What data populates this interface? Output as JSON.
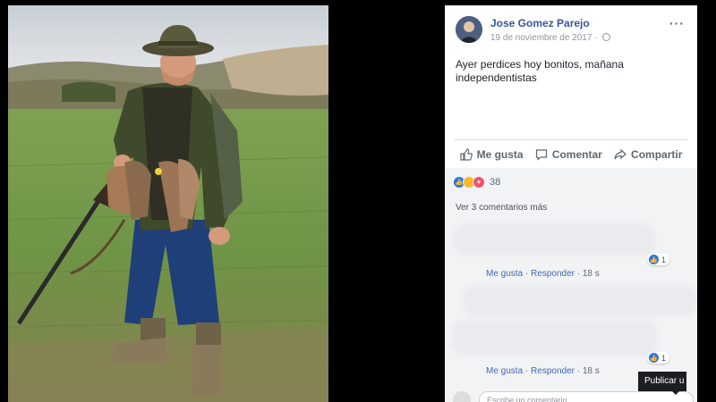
{
  "post": {
    "author": "Jose Gomez Parejo",
    "date": "19 de noviembre de 2017 ·",
    "text": "Ayer perdices hoy bonitos, mañana independentistas",
    "more_icon": "ellipsis-icon"
  },
  "actions": {
    "like": "Me gusta",
    "comment": "Comentar",
    "share": "Compartir"
  },
  "reactions": {
    "icons": [
      "like-icon",
      "haha-icon",
      "love-icon"
    ],
    "count": "38"
  },
  "comments": {
    "view_more": "Ver 3 comentarios más",
    "items": [
      {
        "like_label": "Me gusta",
        "reply_label": "Responder",
        "time": "· 18 s",
        "likes": "1"
      },
      {
        "like_label": "Me gusta",
        "reply_label": "Responder",
        "time": "· 18 s",
        "likes": "1"
      }
    ],
    "sep": "·",
    "composer_placeholder": "Escribe un comentario..."
  },
  "tooltip": {
    "text": "Publicar u"
  },
  "colors": {
    "link": "#365899",
    "accent": "#4267b2",
    "like_blue": "#2e73ed",
    "love_red": "#f25268",
    "haha_yellow": "#f7b928"
  }
}
